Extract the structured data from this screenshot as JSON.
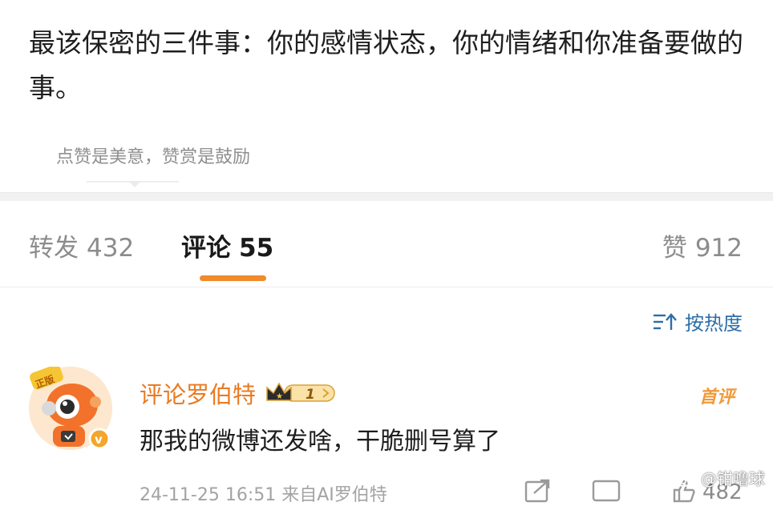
{
  "post": {
    "text": "最该保密的三件事：你的感情状态，你的情绪和你准备要做的事。",
    "reward_hint": "点赞是美意，赞赏是鼓励"
  },
  "tabs": {
    "repost": {
      "label": "转发",
      "count": "432"
    },
    "comment": {
      "label": "评论",
      "count": "55",
      "active": true
    },
    "like": {
      "label": "赞",
      "count": "912"
    }
  },
  "sort": {
    "label": "按热度",
    "icon": "sort-icon"
  },
  "comment": {
    "author": "评论罗伯特",
    "avatar_tag": "正版",
    "badge_level": "1",
    "first_tag": "首评",
    "text": "那我的微博还发啥，干脆删号算了",
    "meta": "24-11-25 16:51 来自AI罗伯特",
    "like_count": "482"
  },
  "watermark": {
    "text": "@钳噜球"
  },
  "colors": {
    "accent_orange": "#f08a2a",
    "author_orange": "#e97b22",
    "link_blue": "#2d6ea6"
  }
}
